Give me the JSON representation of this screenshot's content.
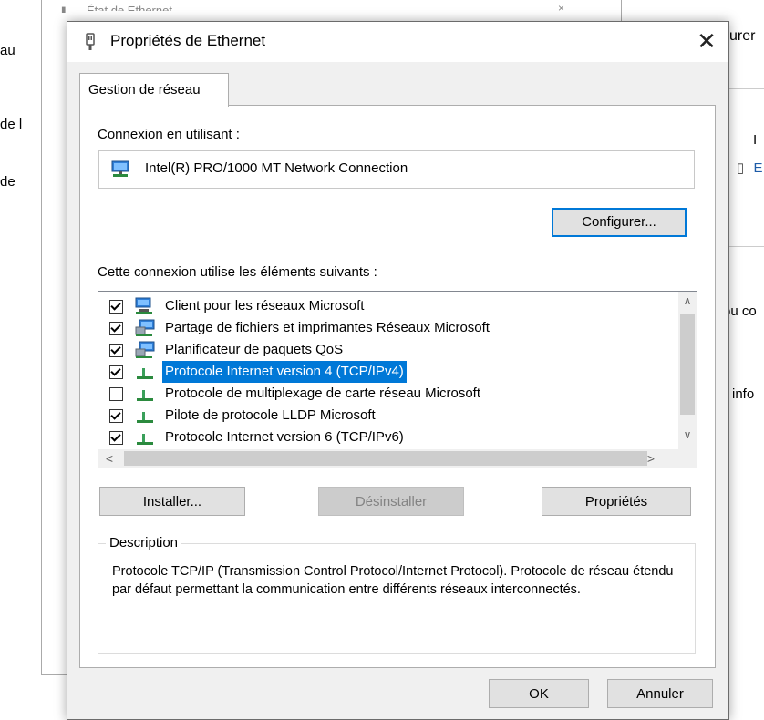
{
  "background": {
    "window_title": "État de Ethernet",
    "close_label": "×",
    "left_fragments": [
      "au",
      "de l",
      "de"
    ],
    "right_top_fragment": "urer",
    "right_fragments": [
      "I",
      "E",
      "ou co",
      "info"
    ]
  },
  "dialog": {
    "title": "Propriétés de Ethernet",
    "close_label": "✕",
    "tab_label": "Gestion de réseau",
    "connect_using_label": "Connexion en utilisant :",
    "adapter_name": "Intel(R) PRO/1000 MT Network Connection",
    "configure_button": "Configurer...",
    "items_label": "Cette connexion utilise les éléments suivants :",
    "items": [
      {
        "label": "Client pour les réseaux Microsoft",
        "checked": true,
        "icon": "network-client-icon",
        "selected": false
      },
      {
        "label": "Partage de fichiers et imprimantes Réseaux Microsoft",
        "checked": true,
        "icon": "network-service-icon",
        "selected": false
      },
      {
        "label": "Planificateur de paquets QoS",
        "checked": true,
        "icon": "network-service-icon",
        "selected": false
      },
      {
        "label": "Protocole Internet version 4 (TCP/IPv4)",
        "checked": true,
        "icon": "protocol-icon",
        "selected": true
      },
      {
        "label": "Protocole de multiplexage de carte réseau Microsoft",
        "checked": false,
        "icon": "protocol-icon",
        "selected": false
      },
      {
        "label": "Pilote de protocole LLDP Microsoft",
        "checked": true,
        "icon": "protocol-icon",
        "selected": false
      },
      {
        "label": "Protocole Internet version 6 (TCP/IPv6)",
        "checked": true,
        "icon": "protocol-icon",
        "selected": false
      }
    ],
    "scroll_up": "∧",
    "scroll_down": "∨",
    "scroll_left": "<",
    "scroll_right": ">",
    "install_button": "Installer...",
    "uninstall_button": "Désinstaller",
    "properties_button": "Propriétés",
    "description_title": "Description",
    "description_text": "Protocole TCP/IP (Transmission Control Protocol/Internet Protocol). Protocole de réseau étendu par défaut permettant la communication entre différents réseaux interconnectés.",
    "ok_button": "OK",
    "cancel_button": "Annuler"
  },
  "colors": {
    "selection": "#0078d7",
    "link": "#1e5ca8",
    "dialog_bg": "#f0f0f0",
    "button_bg": "#e1e1e1"
  }
}
